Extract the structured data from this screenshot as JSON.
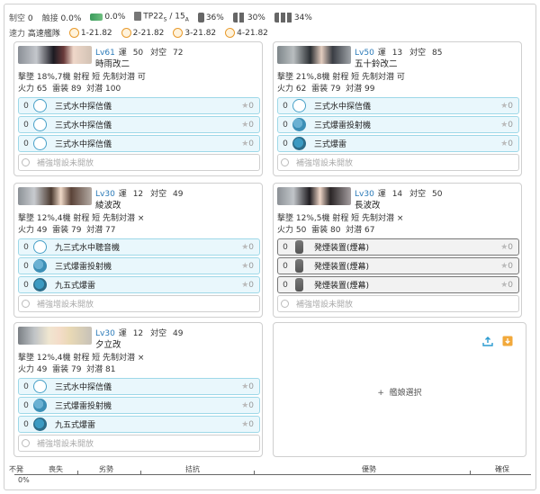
{
  "fleet_summary": {
    "air_control_label": "制空",
    "air_control_value": "0",
    "contact_label": "触接",
    "contact_value": "0.0%",
    "jet_value": "0.0%",
    "tp_label": "TP",
    "tp_value": "22",
    "tp_sub_s": "S",
    "tp_sep": "/",
    "tp_value2": "15",
    "tp_sub_a": "A",
    "drum1_value": "36%",
    "drum2_value": "30%",
    "drum3_value": "34%",
    "speed_label": "速力",
    "speed_value": "高速艦隊",
    "los": [
      {
        "key": "1",
        "value": "-21.82"
      },
      {
        "key": "2",
        "value": "-21.82"
      },
      {
        "key": "3",
        "value": "-21.82"
      },
      {
        "key": "4",
        "value": "-21.82"
      }
    ]
  },
  "ships": [
    {
      "level": "Lv61",
      "luck_label": "運",
      "luck": "50",
      "asw_label": "対空",
      "aa": "72",
      "name": "時雨改二",
      "stat_line1": "撃墜 18%,7機  射程 短  先制対潜 可",
      "fire_label": "火力",
      "fire": "65",
      "torp_label": "雷装",
      "torp": "89",
      "asw2_label": "対潜",
      "asw": "100",
      "equipment": [
        {
          "slot": "0",
          "name": "三式水中探信儀",
          "star": "★",
          "stars": "0",
          "icon": "sonar-icon"
        },
        {
          "slot": "0",
          "name": "三式水中探信儀",
          "star": "★",
          "stars": "0",
          "icon": "sonar-icon"
        },
        {
          "slot": "0",
          "name": "三式水中探信儀",
          "star": "★",
          "stars": "0",
          "icon": "sonar-icon"
        }
      ],
      "expansion": "補強增設未開放"
    },
    {
      "level": "Lv50",
      "luck_label": "運",
      "luck": "13",
      "asw_label": "対空",
      "aa": "85",
      "name": "五十鈴改二",
      "stat_line1": "撃墜 21%,8機  射程 短  先制対潜 可",
      "fire_label": "火力",
      "fire": "62",
      "torp_label": "雷装",
      "torp": "79",
      "asw2_label": "対潜",
      "asw": "99",
      "equipment": [
        {
          "slot": "0",
          "name": "三式水中探信儀",
          "star": "★",
          "stars": "0",
          "icon": "sonar-icon"
        },
        {
          "slot": "0",
          "name": "三式爆雷投射機",
          "star": "★",
          "stars": "0",
          "icon": "depth-charge-projector-icon"
        },
        {
          "slot": "0",
          "name": "三式爆雷",
          "star": "★",
          "stars": "0",
          "icon": "depth-charge-icon"
        }
      ],
      "expansion": "補強增設未開放"
    },
    {
      "level": "Lv30",
      "luck_label": "運",
      "luck": "12",
      "asw_label": "対空",
      "aa": "49",
      "name": "綾波改",
      "stat_line1": "撃墜 12%,4機  射程 短  先制対潜 ×",
      "fire_label": "火力",
      "fire": "49",
      "torp_label": "雷装",
      "torp": "79",
      "asw2_label": "対潜",
      "asw": "77",
      "equipment": [
        {
          "slot": "0",
          "name": "九三式水中聴音機",
          "star": "★",
          "stars": "0",
          "icon": "sonar-icon"
        },
        {
          "slot": "0",
          "name": "三式爆雷投射機",
          "star": "★",
          "stars": "0",
          "icon": "depth-charge-projector-icon"
        },
        {
          "slot": "0",
          "name": "九五式爆雷",
          "star": "★",
          "stars": "0",
          "icon": "depth-charge-icon"
        }
      ],
      "expansion": "補強增設未開放"
    },
    {
      "level": "Lv30",
      "luck_label": "運",
      "luck": "14",
      "asw_label": "対空",
      "aa": "50",
      "name": "長波改",
      "stat_line1": "撃墜 12%,5機  射程 短  先制対潜 ×",
      "fire_label": "火力",
      "fire": "50",
      "torp_label": "雷装",
      "torp": "80",
      "asw2_label": "対潜",
      "asw": "67",
      "equipment": [
        {
          "slot": "0",
          "name": "発煙装置(煙幕)",
          "star": "★",
          "stars": "0",
          "icon": "smoke-generator-icon"
        },
        {
          "slot": "0",
          "name": "発煙装置(煙幕)",
          "star": "★",
          "stars": "0",
          "icon": "smoke-generator-icon"
        },
        {
          "slot": "0",
          "name": "発煙装置(煙幕)",
          "star": "★",
          "stars": "0",
          "icon": "smoke-generator-icon"
        }
      ],
      "expansion": "補強增設未開放"
    },
    {
      "level": "Lv30",
      "luck_label": "運",
      "luck": "12",
      "asw_label": "対空",
      "aa": "49",
      "name": "夕立改",
      "stat_line1": "撃墜 12%,4機  射程 短  先制対潜 ×",
      "fire_label": "火力",
      "fire": "49",
      "torp_label": "雷装",
      "torp": "79",
      "asw2_label": "対潜",
      "asw": "81",
      "equipment": [
        {
          "slot": "0",
          "name": "三式水中探信儀",
          "star": "★",
          "stars": "0",
          "icon": "sonar-icon"
        },
        {
          "slot": "0",
          "name": "三式爆雷投射機",
          "star": "★",
          "stars": "0",
          "icon": "depth-charge-projector-icon"
        },
        {
          "slot": "0",
          "name": "九五式爆雷",
          "star": "★",
          "stars": "0",
          "icon": "depth-charge-icon"
        }
      ],
      "expansion": "補強增設未開放"
    }
  ],
  "empty_slot": {
    "label": "艦娘選択",
    "plus": "+"
  },
  "air_bar": {
    "labels": [
      "不発",
      "喪失",
      "劣勢",
      "拮抗",
      "優勢",
      "確保"
    ],
    "percent": "0%"
  },
  "colors": {
    "accent": "#2a7ab8",
    "equip_bg": "#e9f7fc",
    "equip_border": "#9ed8e8",
    "upload": "#2a9bd1",
    "download": "#f2a93b"
  }
}
